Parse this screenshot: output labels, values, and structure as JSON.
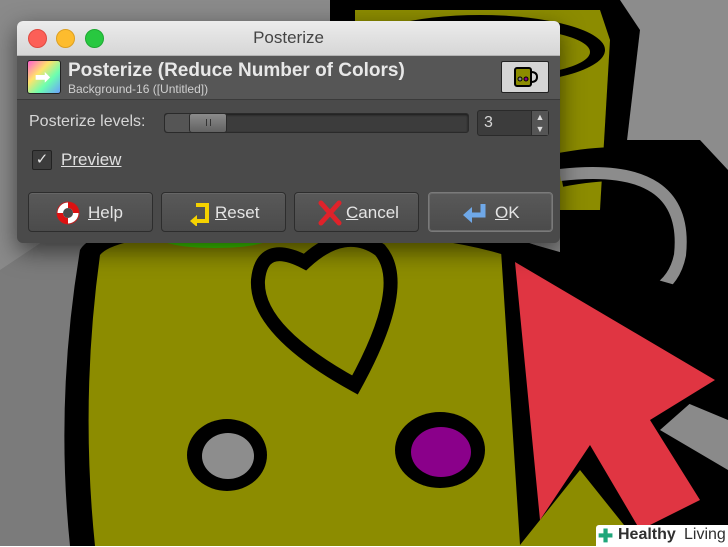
{
  "window": {
    "title": "Posterize"
  },
  "header": {
    "title": "Posterize (Reduce Number of Colors)",
    "subtitle": "Background-16 ([Untitled])",
    "tool_icon": "posterize-tool-icon",
    "thumbnail_icon": "cup-thumbnail-icon"
  },
  "levels": {
    "label": "Posterize levels:",
    "value": "3",
    "slider_fraction": 0.09
  },
  "preview": {
    "label": "Preview",
    "checked": true
  },
  "buttons": {
    "help": "Help",
    "reset": "Reset",
    "cancel": "Cancel",
    "ok": "OK"
  },
  "watermark": {
    "brand_bold": "Healthy",
    "brand_light": "Living"
  },
  "colors": {
    "dialog_bg": "#4a4a4a",
    "cup_fill": "#8c8c00",
    "face_eye_purple": "#8a008a",
    "cursor_red": "#e03542"
  }
}
